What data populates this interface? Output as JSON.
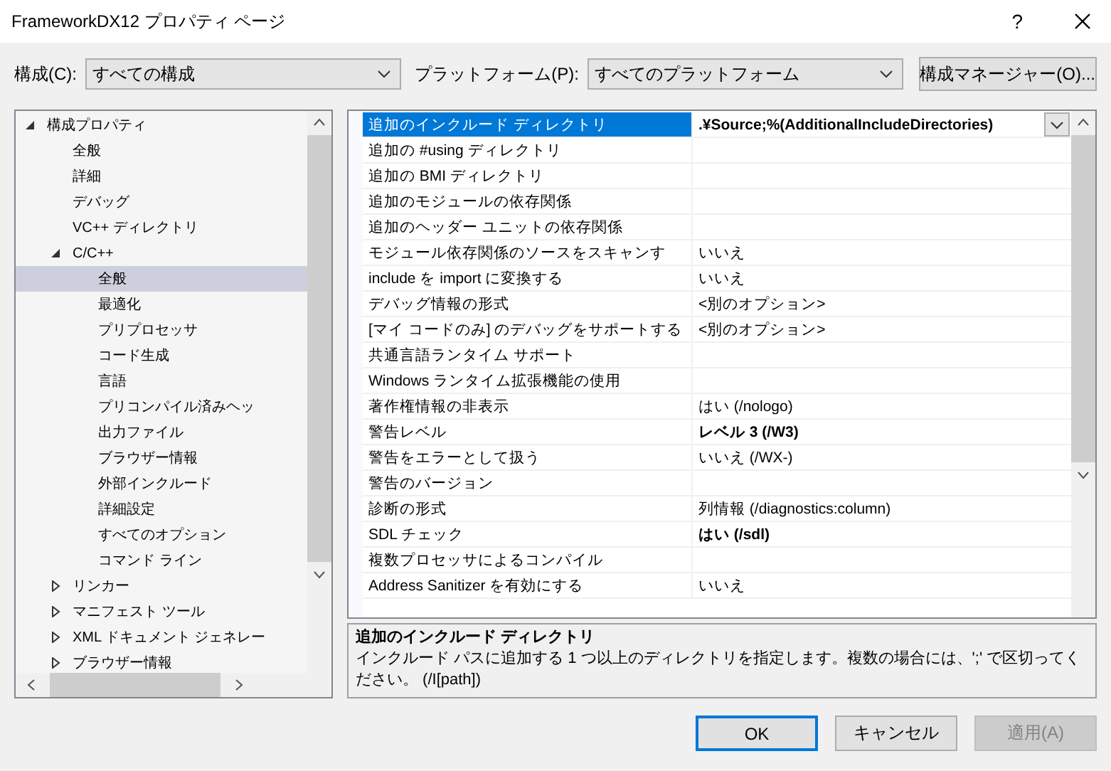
{
  "window": {
    "title": "FrameworkDX12 プロパティ ページ",
    "help": "?"
  },
  "toolbar": {
    "configuration_label": "構成(C):",
    "configuration_value": "すべての構成",
    "platform_label": "プラットフォーム(P):",
    "platform_value": "すべてのプラットフォーム",
    "manager_button": "構成マネージャー(O)..."
  },
  "tree": [
    {
      "label": "構成プロパティ",
      "expanded": true,
      "selected": false,
      "children": [
        {
          "label": "全般",
          "selected": false
        },
        {
          "label": "詳細",
          "selected": false
        },
        {
          "label": "デバッグ",
          "selected": false
        },
        {
          "label": "VC++ ディレクトリ",
          "selected": false
        },
        {
          "label": "C/C++",
          "expanded": true,
          "selected": false,
          "children": [
            {
              "label": "全般",
              "selected": true
            },
            {
              "label": "最適化",
              "selected": false
            },
            {
              "label": "プリプロセッサ",
              "selected": false
            },
            {
              "label": "コード生成",
              "selected": false
            },
            {
              "label": "言語",
              "selected": false
            },
            {
              "label": "プリコンパイル済みヘッ",
              "selected": false
            },
            {
              "label": "出力ファイル",
              "selected": false
            },
            {
              "label": "ブラウザー情報",
              "selected": false
            },
            {
              "label": "外部インクルード",
              "selected": false
            },
            {
              "label": "詳細設定",
              "selected": false
            },
            {
              "label": "すべてのオプション",
              "selected": false
            },
            {
              "label": "コマンド ライン",
              "selected": false
            }
          ]
        },
        {
          "label": "リンカー",
          "expanded": false,
          "selected": false
        },
        {
          "label": "マニフェスト ツール",
          "expanded": false,
          "selected": false
        },
        {
          "label": "XML ドキュメント ジェネレー",
          "expanded": false,
          "selected": false
        },
        {
          "label": "ブラウザー情報",
          "expanded": false,
          "selected": false
        }
      ]
    }
  ],
  "properties": [
    {
      "name": "追加のインクルード ディレクトリ",
      "value": ".¥Source;%(AdditionalIncludeDirectories)",
      "non_default": true,
      "selected": true
    },
    {
      "name": "追加の #using ディレクトリ",
      "selected": false
    },
    {
      "name": "追加の BMI ディレクトリ",
      "selected": false
    },
    {
      "name": "追加のモジュールの依存関係",
      "selected": false
    },
    {
      "name": "追加のヘッダー ユニットの依存関係",
      "selected": false
    },
    {
      "name": "モジュール依存関係のソースをスキャンす",
      "value": "いいえ",
      "non_default": false,
      "selected": false
    },
    {
      "name": "include を import に変換する",
      "value": "いいえ",
      "non_default": false,
      "selected": false
    },
    {
      "name": "デバッグ情報の形式",
      "value": "<別のオプション>",
      "non_default": false,
      "selected": false
    },
    {
      "name": "[マイ コードのみ] のデバッグをサポートする",
      "value": "<別のオプション>",
      "non_default": false,
      "selected": false
    },
    {
      "name": "共通言語ランタイム サポート",
      "selected": false
    },
    {
      "name": "Windows ランタイム拡張機能の使用",
      "selected": false
    },
    {
      "name": "著作権情報の非表示",
      "value": "はい (/nologo)",
      "non_default": false,
      "selected": false
    },
    {
      "name": "警告レベル",
      "value": "レベル 3 (/W3)",
      "non_default": true,
      "selected": false
    },
    {
      "name": "警告をエラーとして扱う",
      "value": "いいえ (/WX-)",
      "non_default": false,
      "selected": false
    },
    {
      "name": "警告のバージョン",
      "selected": false
    },
    {
      "name": "診断の形式",
      "value": "列情報 (/diagnostics:column)",
      "non_default": false,
      "selected": false
    },
    {
      "name": "SDL チェック",
      "value": "はい (/sdl)",
      "non_default": true,
      "selected": false
    },
    {
      "name": "複数プロセッサによるコンパイル",
      "selected": false
    },
    {
      "name": "Address Sanitizer を有効にする",
      "value": "いいえ",
      "non_default": false,
      "selected": false
    }
  ],
  "description": {
    "title": "追加のインクルード ディレクトリ",
    "text": "インクルード パスに追加する 1 つ以上のディレクトリを指定します。複数の場合には、';' で区切ってください。 (/I[path])"
  },
  "buttons": [
    {
      "label": "OK",
      "kind": "default",
      "disabled": false
    },
    {
      "label": "キャンセル",
      "kind": "normal",
      "disabled": false
    },
    {
      "label": "適用(A)",
      "kind": "normal",
      "disabled": true
    }
  ]
}
